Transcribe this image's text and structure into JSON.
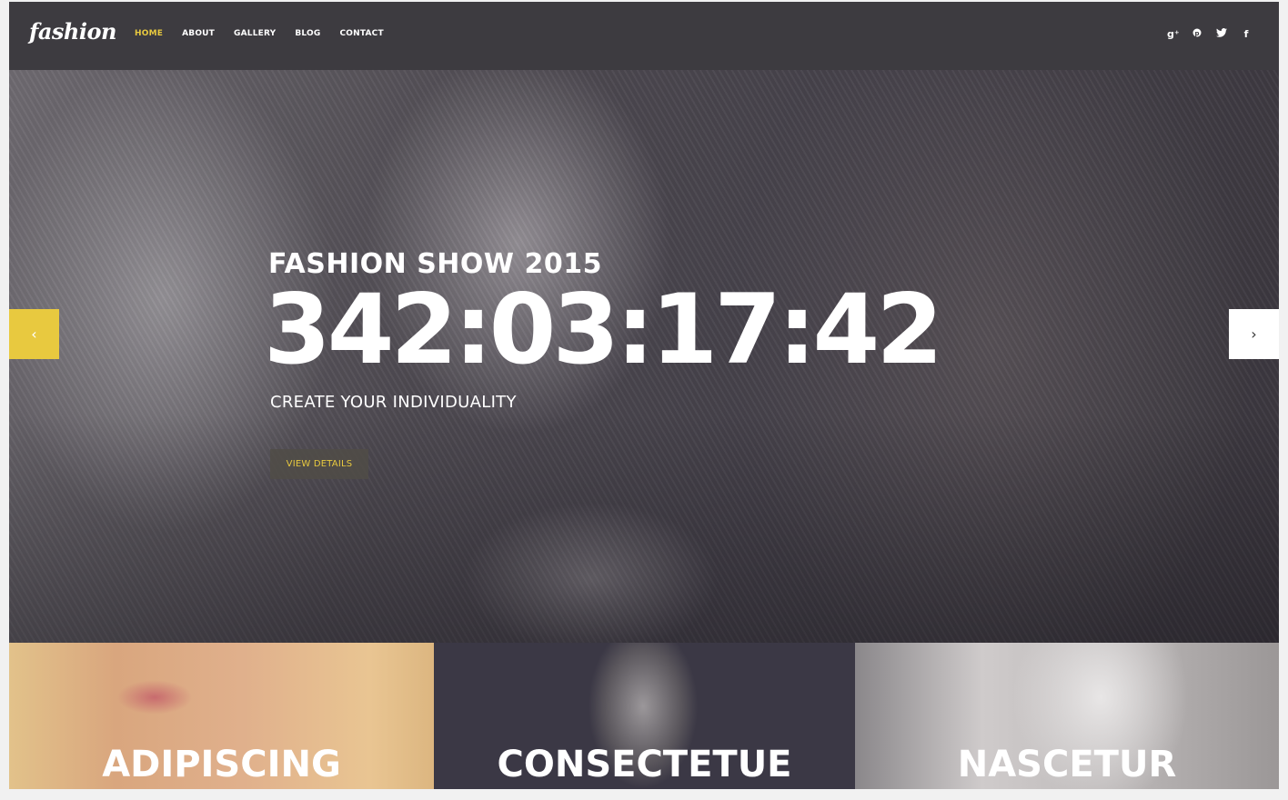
{
  "header": {
    "logo": "fashion",
    "nav": [
      {
        "label": "HOME",
        "active": true
      },
      {
        "label": "ABOUT",
        "active": false
      },
      {
        "label": "GALLERY",
        "active": false
      },
      {
        "label": "BLOG",
        "active": false
      },
      {
        "label": "CONTACT",
        "active": false
      }
    ],
    "social": [
      {
        "icon": "google-plus-icon",
        "glyph": "g⁺"
      },
      {
        "icon": "pinterest-icon",
        "glyph": "℗"
      },
      {
        "icon": "twitter-icon",
        "glyph": "🐦"
      },
      {
        "icon": "facebook-icon",
        "glyph": "f"
      }
    ]
  },
  "hero": {
    "subtitle": "FASHION SHOW 2015",
    "countdown": "342:03:17:42",
    "tagline": "CREATE YOUR INDIVIDUALITY",
    "button_label": "VIEW DETAILS",
    "prev_glyph": "‹",
    "next_glyph": "›"
  },
  "tiles": [
    {
      "label": "ADIPISCING"
    },
    {
      "label": "CONSECTETUE"
    },
    {
      "label": "NASCETUR"
    }
  ],
  "colors": {
    "accent": "#e8c93f",
    "header_bg": "#3d3b40"
  }
}
